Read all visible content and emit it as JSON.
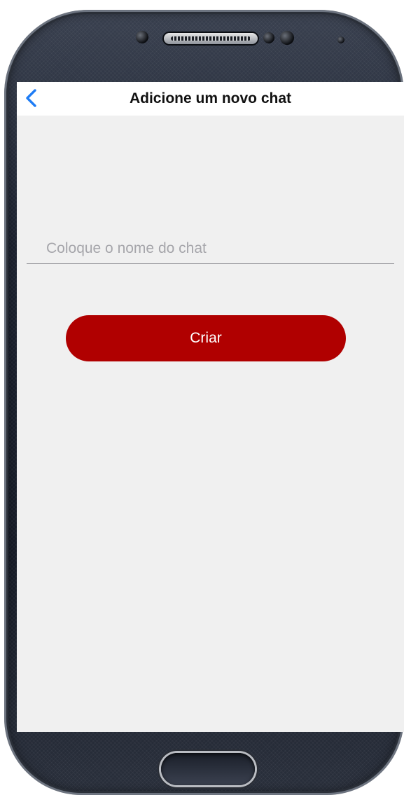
{
  "header": {
    "title": "Adicione um novo chat",
    "back_icon": "chevron-left-icon"
  },
  "form": {
    "chat_name": {
      "placeholder": "Coloque o nome do chat",
      "value": ""
    },
    "create_label": "Criar"
  },
  "colors": {
    "accent_back": "#1e7cf5",
    "create_button": "#b00000",
    "screen_background": "#f0f0f0",
    "navbar_background": "#ffffff"
  }
}
